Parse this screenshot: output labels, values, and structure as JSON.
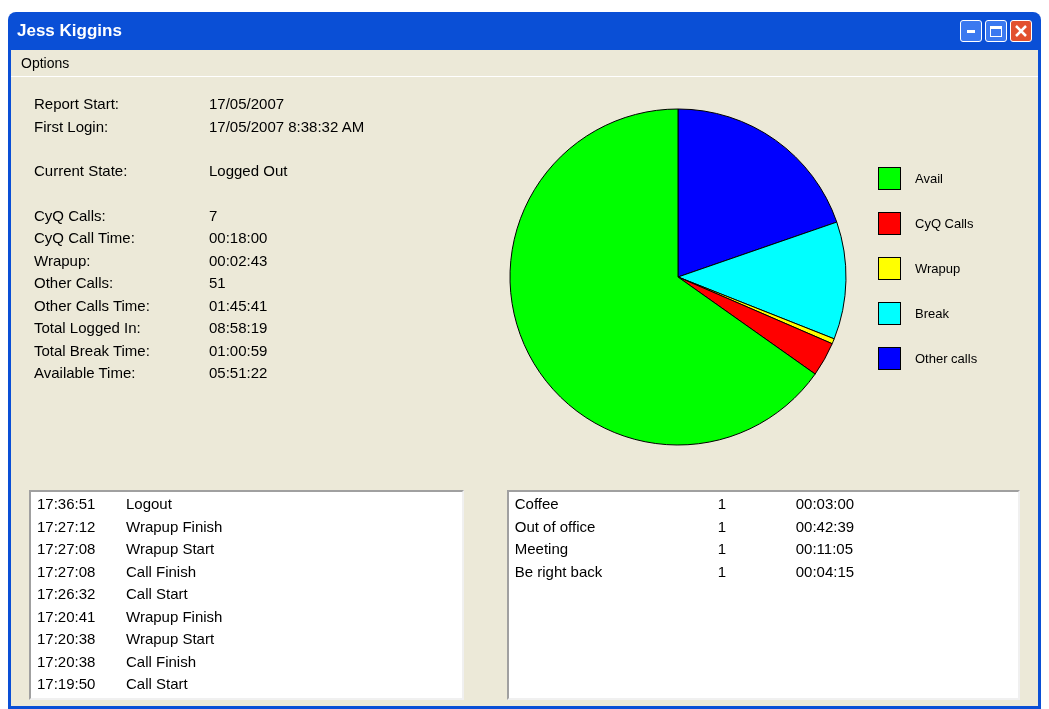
{
  "window": {
    "title": "Jess Kiggins"
  },
  "menu": [
    "Options"
  ],
  "stat_groups": [
    [
      {
        "label": "Report Start:",
        "value": "17/05/2007"
      },
      {
        "label": "First Login:",
        "value": "17/05/2007 8:38:32 AM"
      }
    ],
    [
      {
        "label": "Current State:",
        "value": "Logged Out"
      }
    ],
    [
      {
        "label": "CyQ Calls:",
        "value": "7"
      },
      {
        "label": "CyQ Call Time:",
        "value": "00:18:00"
      },
      {
        "label": "Wrapup:",
        "value": "00:02:43"
      },
      {
        "label": "Other Calls:",
        "value": "51"
      },
      {
        "label": "Other Calls Time:",
        "value": "01:45:41"
      },
      {
        "label": "Total Logged In:",
        "value": "08:58:19"
      },
      {
        "label": "Total Break Time:",
        "value": "01:00:59"
      },
      {
        "label": "Available Time:",
        "value": "05:51:22"
      }
    ]
  ],
  "legend": [
    {
      "label": "Avail",
      "color": "#00ff00"
    },
    {
      "label": "CyQ Calls",
      "color": "#ff0000"
    },
    {
      "label": "Wrapup",
      "color": "#ffff00"
    },
    {
      "label": "Break",
      "color": "#00ffff"
    },
    {
      "label": "Other calls",
      "color": "#0000ff"
    }
  ],
  "events": [
    {
      "time": "17:36:51",
      "event": "Logout"
    },
    {
      "time": "17:27:12",
      "event": "Wrapup Finish"
    },
    {
      "time": "17:27:08",
      "event": "Wrapup Start"
    },
    {
      "time": "17:27:08",
      "event": "Call Finish"
    },
    {
      "time": "17:26:32",
      "event": "Call Start"
    },
    {
      "time": "17:20:41",
      "event": "Wrapup Finish"
    },
    {
      "time": "17:20:38",
      "event": "Wrapup Start"
    },
    {
      "time": "17:20:38",
      "event": "Call Finish"
    },
    {
      "time": "17:19:50",
      "event": "Call Start"
    }
  ],
  "breaks": [
    {
      "name": "Coffee",
      "count": "1",
      "duration": "00:03:00"
    },
    {
      "name": "Out of office",
      "count": "1",
      "duration": "00:42:39"
    },
    {
      "name": "Meeting",
      "count": "1",
      "duration": "00:11:05"
    },
    {
      "name": "Be right back",
      "count": "1",
      "duration": "00:04:15"
    }
  ]
}
